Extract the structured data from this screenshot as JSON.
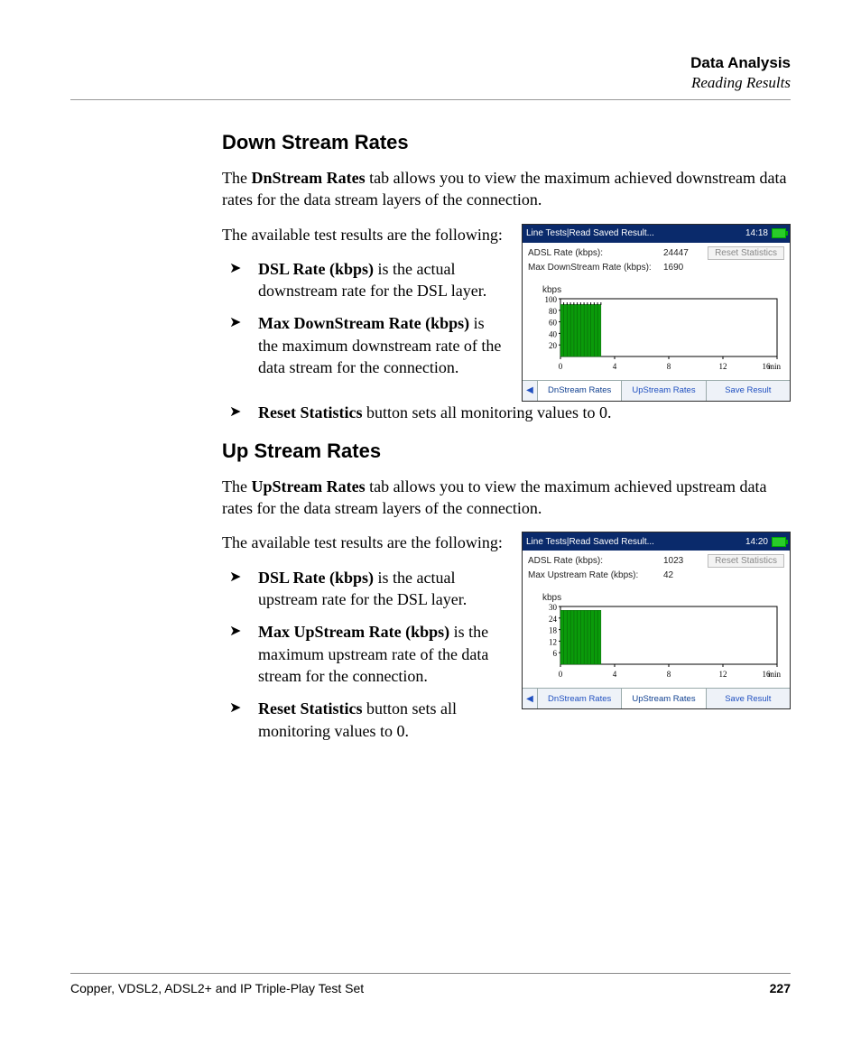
{
  "header": {
    "chapter": "Data Analysis",
    "section": "Reading Results"
  },
  "down": {
    "heading": "Down Stream Rates",
    "intro_prefix": "The ",
    "intro_bold": "DnStream Rates",
    "intro_suffix": " tab allows you to view the maximum achieved downstream data rates for the data stream layers of the connection.",
    "avail": "The available test results are the following:",
    "b1_bold": "DSL Rate (kbps)",
    "b1_rest": " is the actual downstream rate for the DSL layer.",
    "b2_bold": "Max DownStream Rate (kbps)",
    "b2_rest": " is the maximum downstream rate of the data stream for the connection.",
    "b3_bold": "Reset Statistics",
    "b3_rest": " button sets all monitoring values to 0."
  },
  "up": {
    "heading": "Up Stream Rates",
    "intro_prefix": "The ",
    "intro_bold": "UpStream Rates",
    "intro_suffix": " tab allows you to view the maximum achieved upstream data rates for the data stream layers of the connection.",
    "avail": "The available test results are the following:",
    "b1_bold": "DSL Rate (kbps)",
    "b1_rest": " is the actual upstream rate for the DSL layer.",
    "b2_bold": "Max UpStream Rate (kbps)",
    "b2_rest": " is the maximum upstream rate of the data stream for the connection.",
    "b3_bold": "Reset Statistics",
    "b3_rest": " button sets all monitoring values to 0."
  },
  "panel_down": {
    "title": "Line Tests|Read Saved Result...",
    "time": "14:18",
    "row1_label": "ADSL Rate (kbps):",
    "row1_value": "24447",
    "row2_label": "Max DownStream Rate (kbps):",
    "row2_value": "1690",
    "reset_label": "Reset Statistics",
    "y_unit": "kbps",
    "x_unit": "min",
    "tabs": {
      "t1": "DnStream Rates",
      "t2": "UpStream Rates",
      "t3": "Save Result"
    }
  },
  "panel_up": {
    "title": "Line Tests|Read Saved Result...",
    "time": "14:20",
    "row1_label": "ADSL Rate (kbps):",
    "row1_value": "1023",
    "row2_label": "Max Upstream Rate (kbps):",
    "row2_value": "42",
    "reset_label": "Reset Statistics",
    "y_unit": "kbps",
    "x_unit": "min",
    "tabs": {
      "t1": "DnStream Rates",
      "t2": "UpStream Rates",
      "t3": "Save Result"
    }
  },
  "chart_data": [
    {
      "type": "bar",
      "title": "Max DownStream Rate",
      "ylabel": "kbps",
      "xlabel": "min",
      "ylim": [
        0,
        100
      ],
      "xlim": [
        0,
        16
      ],
      "y_ticks": [
        20,
        40,
        60,
        80,
        100
      ],
      "x_ticks": [
        0,
        4,
        8,
        12,
        16
      ],
      "series": [
        {
          "name": "rate",
          "x": [
            0,
            0.25,
            0.5,
            0.75,
            1,
            1.25,
            1.5,
            1.75,
            2,
            2.25,
            2.5,
            2.75
          ],
          "values": [
            90,
            90,
            90,
            90,
            90,
            90,
            90,
            90,
            90,
            90,
            90,
            90
          ]
        }
      ]
    },
    {
      "type": "bar",
      "title": "Max Upstream Rate",
      "ylabel": "kbps",
      "xlabel": "min",
      "ylim": [
        0,
        30
      ],
      "xlim": [
        0,
        16
      ],
      "y_ticks": [
        6,
        12,
        18,
        24,
        30
      ],
      "x_ticks": [
        0,
        4,
        8,
        12,
        16
      ],
      "series": [
        {
          "name": "rate",
          "x": [
            0,
            0.25,
            0.5,
            0.75,
            1,
            1.25,
            1.5,
            1.75,
            2,
            2.25,
            2.5,
            2.75
          ],
          "values": [
            28,
            28,
            28,
            28,
            28,
            28,
            28,
            28,
            28,
            28,
            28,
            28
          ]
        }
      ]
    }
  ],
  "footer": {
    "left": "Copper, VDSL2, ADSL2+ and IP Triple-Play Test Set",
    "page": "227"
  }
}
